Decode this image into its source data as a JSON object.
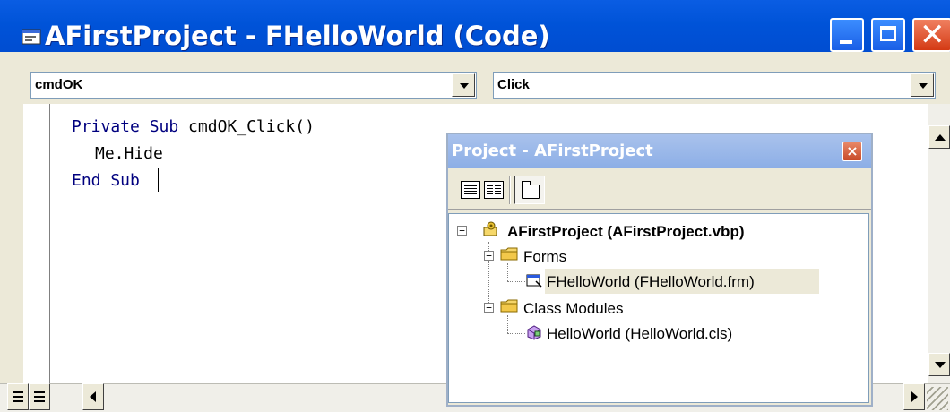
{
  "window": {
    "title": "AFirstProject - FHelloWorld (Code)",
    "icon": "code-window-icon",
    "buttons": [
      "minimize-icon",
      "maximize-icon",
      "close-icon"
    ]
  },
  "object_combo": {
    "value": "cmdOK"
  },
  "procedure_combo": {
    "value": "Click"
  },
  "code": {
    "line1_kw1": "Private Sub",
    "line1_rest": " cmdOK_Click()",
    "line2": "Me.Hide",
    "line3": "End Sub"
  },
  "project_explorer": {
    "title": "Project - AFirstProject",
    "close": "×",
    "toolbar": [
      "view-code-icon",
      "view-object-icon",
      "toggle-folders-icon"
    ],
    "tree": {
      "project": "AFirstProject (AFirstProject.vbp)",
      "forms_folder": "Forms",
      "form_item": "FHelloWorld (FHelloWorld.frm)",
      "classes_folder": "Class Modules",
      "class_item": "HelloWorld (HelloWorld.cls)"
    }
  },
  "colors": {
    "title_bar": "#0053d8",
    "keyword": "#00007f",
    "project_title_bar": "#8caee6",
    "selection": "#ece9d8"
  }
}
